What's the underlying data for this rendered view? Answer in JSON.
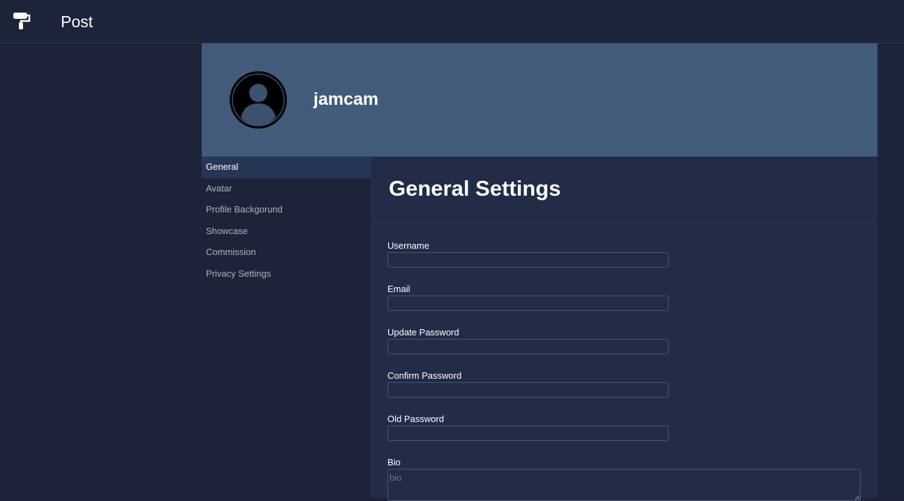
{
  "header": {
    "app_title": "Post",
    "logo_icon": "paint-roller-icon"
  },
  "profile": {
    "username": "jamcam",
    "avatar_icon": "user-avatar-icon"
  },
  "sidebar": {
    "items": [
      {
        "label": "General",
        "active": true
      },
      {
        "label": "Avatar",
        "active": false
      },
      {
        "label": "Profile Backgorund",
        "active": false
      },
      {
        "label": "Showcase",
        "active": false
      },
      {
        "label": "Commission",
        "active": false
      },
      {
        "label": "Privacy Settings",
        "active": false
      }
    ]
  },
  "main": {
    "title": "General Settings",
    "fields": {
      "username": {
        "label": "Username",
        "value": ""
      },
      "email": {
        "label": "Email",
        "value": ""
      },
      "update_password": {
        "label": "Update Password",
        "value": ""
      },
      "confirm_password": {
        "label": "Confirm Password",
        "value": ""
      },
      "old_password": {
        "label": "Old Password",
        "value": ""
      },
      "bio": {
        "label": "Bio",
        "value": "",
        "placeholder": "bio"
      }
    }
  },
  "colors": {
    "background": "#1d2439",
    "banner": "#425b7b",
    "content_panel": "#222c47",
    "active_nav": "#283656"
  }
}
